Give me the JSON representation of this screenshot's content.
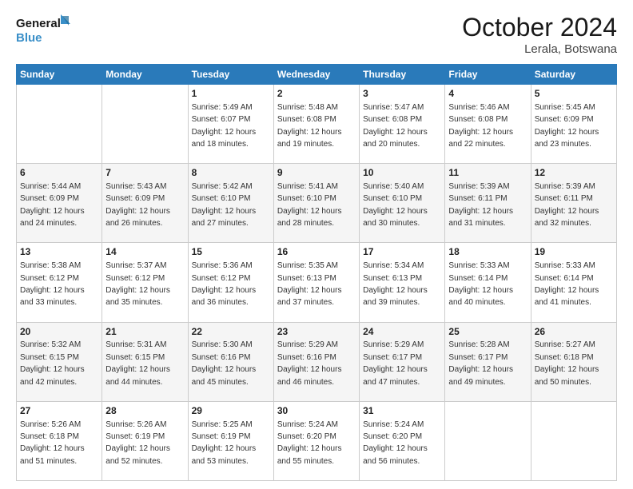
{
  "header": {
    "logo_line1": "General",
    "logo_line2": "Blue",
    "month": "October 2024",
    "location": "Lerala, Botswana"
  },
  "days_of_week": [
    "Sunday",
    "Monday",
    "Tuesday",
    "Wednesday",
    "Thursday",
    "Friday",
    "Saturday"
  ],
  "weeks": [
    [
      {
        "day": "",
        "sunrise": "",
        "sunset": "",
        "daylight": ""
      },
      {
        "day": "",
        "sunrise": "",
        "sunset": "",
        "daylight": ""
      },
      {
        "day": "1",
        "sunrise": "Sunrise: 5:49 AM",
        "sunset": "Sunset: 6:07 PM",
        "daylight": "Daylight: 12 hours and 18 minutes."
      },
      {
        "day": "2",
        "sunrise": "Sunrise: 5:48 AM",
        "sunset": "Sunset: 6:08 PM",
        "daylight": "Daylight: 12 hours and 19 minutes."
      },
      {
        "day": "3",
        "sunrise": "Sunrise: 5:47 AM",
        "sunset": "Sunset: 6:08 PM",
        "daylight": "Daylight: 12 hours and 20 minutes."
      },
      {
        "day": "4",
        "sunrise": "Sunrise: 5:46 AM",
        "sunset": "Sunset: 6:08 PM",
        "daylight": "Daylight: 12 hours and 22 minutes."
      },
      {
        "day": "5",
        "sunrise": "Sunrise: 5:45 AM",
        "sunset": "Sunset: 6:09 PM",
        "daylight": "Daylight: 12 hours and 23 minutes."
      }
    ],
    [
      {
        "day": "6",
        "sunrise": "Sunrise: 5:44 AM",
        "sunset": "Sunset: 6:09 PM",
        "daylight": "Daylight: 12 hours and 24 minutes."
      },
      {
        "day": "7",
        "sunrise": "Sunrise: 5:43 AM",
        "sunset": "Sunset: 6:09 PM",
        "daylight": "Daylight: 12 hours and 26 minutes."
      },
      {
        "day": "8",
        "sunrise": "Sunrise: 5:42 AM",
        "sunset": "Sunset: 6:10 PM",
        "daylight": "Daylight: 12 hours and 27 minutes."
      },
      {
        "day": "9",
        "sunrise": "Sunrise: 5:41 AM",
        "sunset": "Sunset: 6:10 PM",
        "daylight": "Daylight: 12 hours and 28 minutes."
      },
      {
        "day": "10",
        "sunrise": "Sunrise: 5:40 AM",
        "sunset": "Sunset: 6:10 PM",
        "daylight": "Daylight: 12 hours and 30 minutes."
      },
      {
        "day": "11",
        "sunrise": "Sunrise: 5:39 AM",
        "sunset": "Sunset: 6:11 PM",
        "daylight": "Daylight: 12 hours and 31 minutes."
      },
      {
        "day": "12",
        "sunrise": "Sunrise: 5:39 AM",
        "sunset": "Sunset: 6:11 PM",
        "daylight": "Daylight: 12 hours and 32 minutes."
      }
    ],
    [
      {
        "day": "13",
        "sunrise": "Sunrise: 5:38 AM",
        "sunset": "Sunset: 6:12 PM",
        "daylight": "Daylight: 12 hours and 33 minutes."
      },
      {
        "day": "14",
        "sunrise": "Sunrise: 5:37 AM",
        "sunset": "Sunset: 6:12 PM",
        "daylight": "Daylight: 12 hours and 35 minutes."
      },
      {
        "day": "15",
        "sunrise": "Sunrise: 5:36 AM",
        "sunset": "Sunset: 6:12 PM",
        "daylight": "Daylight: 12 hours and 36 minutes."
      },
      {
        "day": "16",
        "sunrise": "Sunrise: 5:35 AM",
        "sunset": "Sunset: 6:13 PM",
        "daylight": "Daylight: 12 hours and 37 minutes."
      },
      {
        "day": "17",
        "sunrise": "Sunrise: 5:34 AM",
        "sunset": "Sunset: 6:13 PM",
        "daylight": "Daylight: 12 hours and 39 minutes."
      },
      {
        "day": "18",
        "sunrise": "Sunrise: 5:33 AM",
        "sunset": "Sunset: 6:14 PM",
        "daylight": "Daylight: 12 hours and 40 minutes."
      },
      {
        "day": "19",
        "sunrise": "Sunrise: 5:33 AM",
        "sunset": "Sunset: 6:14 PM",
        "daylight": "Daylight: 12 hours and 41 minutes."
      }
    ],
    [
      {
        "day": "20",
        "sunrise": "Sunrise: 5:32 AM",
        "sunset": "Sunset: 6:15 PM",
        "daylight": "Daylight: 12 hours and 42 minutes."
      },
      {
        "day": "21",
        "sunrise": "Sunrise: 5:31 AM",
        "sunset": "Sunset: 6:15 PM",
        "daylight": "Daylight: 12 hours and 44 minutes."
      },
      {
        "day": "22",
        "sunrise": "Sunrise: 5:30 AM",
        "sunset": "Sunset: 6:16 PM",
        "daylight": "Daylight: 12 hours and 45 minutes."
      },
      {
        "day": "23",
        "sunrise": "Sunrise: 5:29 AM",
        "sunset": "Sunset: 6:16 PM",
        "daylight": "Daylight: 12 hours and 46 minutes."
      },
      {
        "day": "24",
        "sunrise": "Sunrise: 5:29 AM",
        "sunset": "Sunset: 6:17 PM",
        "daylight": "Daylight: 12 hours and 47 minutes."
      },
      {
        "day": "25",
        "sunrise": "Sunrise: 5:28 AM",
        "sunset": "Sunset: 6:17 PM",
        "daylight": "Daylight: 12 hours and 49 minutes."
      },
      {
        "day": "26",
        "sunrise": "Sunrise: 5:27 AM",
        "sunset": "Sunset: 6:18 PM",
        "daylight": "Daylight: 12 hours and 50 minutes."
      }
    ],
    [
      {
        "day": "27",
        "sunrise": "Sunrise: 5:26 AM",
        "sunset": "Sunset: 6:18 PM",
        "daylight": "Daylight: 12 hours and 51 minutes."
      },
      {
        "day": "28",
        "sunrise": "Sunrise: 5:26 AM",
        "sunset": "Sunset: 6:19 PM",
        "daylight": "Daylight: 12 hours and 52 minutes."
      },
      {
        "day": "29",
        "sunrise": "Sunrise: 5:25 AM",
        "sunset": "Sunset: 6:19 PM",
        "daylight": "Daylight: 12 hours and 53 minutes."
      },
      {
        "day": "30",
        "sunrise": "Sunrise: 5:24 AM",
        "sunset": "Sunset: 6:20 PM",
        "daylight": "Daylight: 12 hours and 55 minutes."
      },
      {
        "day": "31",
        "sunrise": "Sunrise: 5:24 AM",
        "sunset": "Sunset: 6:20 PM",
        "daylight": "Daylight: 12 hours and 56 minutes."
      },
      {
        "day": "",
        "sunrise": "",
        "sunset": "",
        "daylight": ""
      },
      {
        "day": "",
        "sunrise": "",
        "sunset": "",
        "daylight": ""
      }
    ]
  ]
}
